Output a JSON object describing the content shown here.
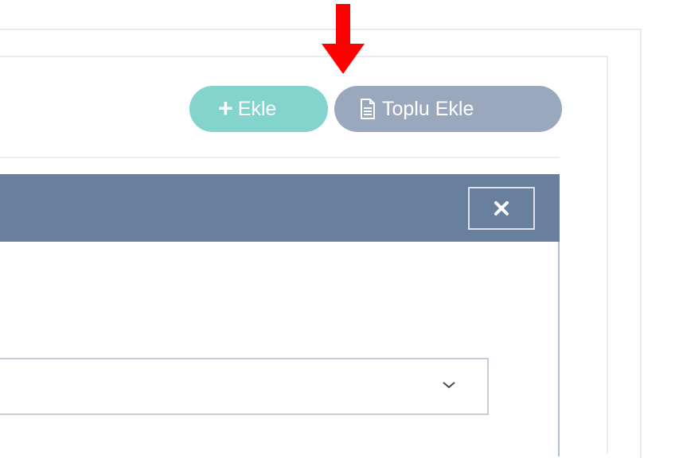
{
  "toolbar": {
    "add_label": "Ekle",
    "bulk_add_label": "Toplu Ekle"
  },
  "icons": {
    "add": "plus-icon",
    "bulk_add": "document-icon",
    "close": "close-icon",
    "dropdown": "chevron-down-icon",
    "indicator": "arrow-down-icon"
  },
  "colors": {
    "add_button": "#82d4cc",
    "bulk_add_button": "#9aa8bd",
    "modal_header": "#687f9e",
    "indicator_arrow": "#ff0000"
  },
  "modal": {
    "select": {
      "value": ""
    }
  }
}
